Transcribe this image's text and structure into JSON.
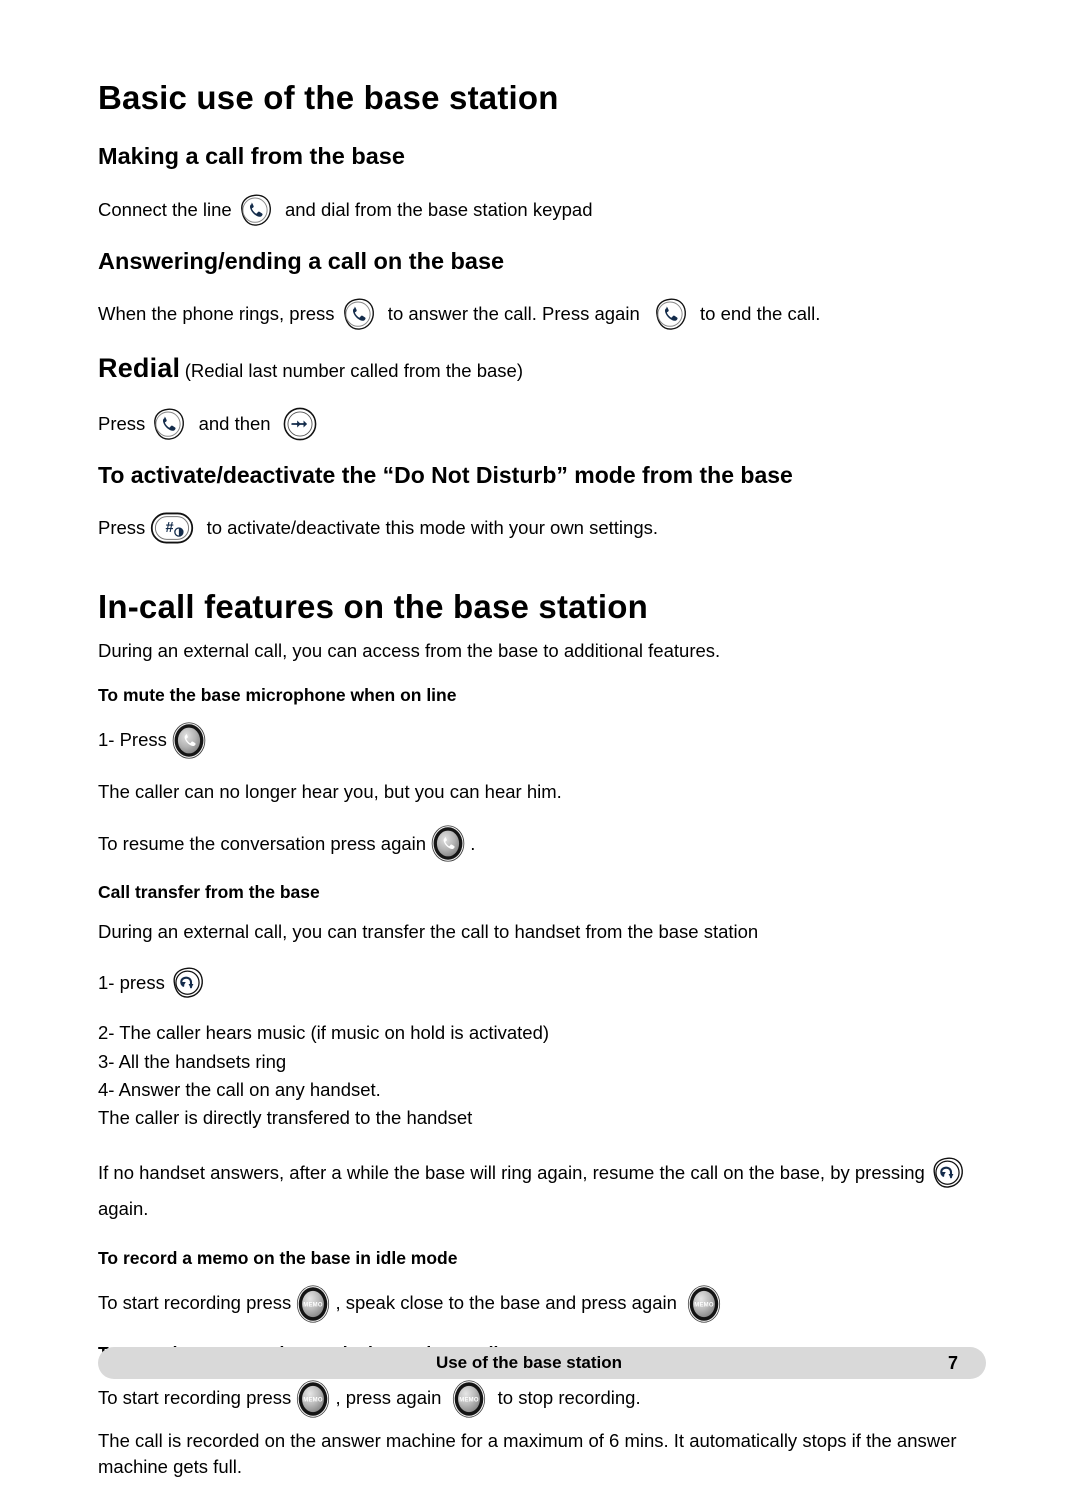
{
  "document": {
    "page_number": "7",
    "footer_title": "Use of the base station"
  },
  "sections": [
    {
      "id": "basic-use",
      "heading": "Basic use of the base station",
      "level": "h1"
    },
    {
      "id": "making-a-call",
      "heading": "Making a call from the base",
      "level": "h2",
      "line_before_icon": "Connect the line ",
      "line_after_icon": " and dial from the base station keypad",
      "icon": "phone-icon"
    },
    {
      "id": "answering-ending",
      "heading": "Answering/ending a call on the base",
      "level": "h2",
      "part1": "When the phone rings, press ",
      "part2": " to answer the call. Press again ",
      "part3": " to end the call."
    },
    {
      "id": "redial",
      "heading_bold": "Redial",
      "heading_rest": " (Redial last number called from the base)",
      "press_label": "Press ",
      "and_then_label": " and then "
    },
    {
      "id": "do-not-disturb",
      "heading": "To activate/deactivate the “Do Not Disturb” mode from the base",
      "level": "h2",
      "press_label": "Press ",
      "after_icon": " to activate/deactivate this mode with your own settings."
    },
    {
      "id": "in-call-features",
      "heading": "In-call features on the base station",
      "level": "h1",
      "intro": "During an external call, you can access from the base to additional features."
    },
    {
      "id": "mute",
      "heading": "To mute the base microphone when on line",
      "level": "h3",
      "step1": "1- Press ",
      "note": "The caller can no longer hear you, but you can hear him.",
      "resume_before": "To resume the conversation press again ",
      "resume_after": "."
    },
    {
      "id": "call-transfer",
      "heading": "Call transfer from the base",
      "level": "h3",
      "intro": "During an external call, you can transfer the call to handset from the base station",
      "step1": "1- press ",
      "step2": "2- The caller hears music (if music on hold is activated)",
      "step3": "3- All the handsets ring",
      "step4": "4- Answer the call on any handset.",
      "step5": "The caller is directly transfered to the handset",
      "fallback_before": "If no handset answers, after a while the base will ring again, resume the call on the base, by pressing ",
      "fallback_after": "again."
    },
    {
      "id": "record-memo",
      "heading": "To record a memo on the base in idle mode",
      "level": "h3",
      "part1": "To start recording press ",
      "part2": ", speak close to the base and press again "
    },
    {
      "id": "record-conversation",
      "heading": "To record a conversation on the base when on line",
      "level": "h3",
      "part1": "To start recording press ",
      "part2": ", press again ",
      "part3": " to stop recording.",
      "note": "The call is recorded on the answer machine for a maximum of 6 mins. It automatically stops if the answer machine gets full."
    }
  ],
  "icons": {
    "phone": "phone-icon",
    "redial": "redial-double-arrow-icon",
    "hash": "hash-do-not-disturb-icon",
    "mute": "mute-phone-icon",
    "recall": "recall-transfer-icon",
    "memo": "memo-button-icon",
    "memo_label": "MEMO"
  },
  "colors": {
    "glyph_navy": "#142c4b",
    "footer_bg": "#d9d9d9",
    "page_bg": "#ffffff",
    "button_gray_light": "#d2d2d2",
    "button_gray_dark": "#8b8b8b",
    "ring_dark": "#1c1c1c"
  }
}
